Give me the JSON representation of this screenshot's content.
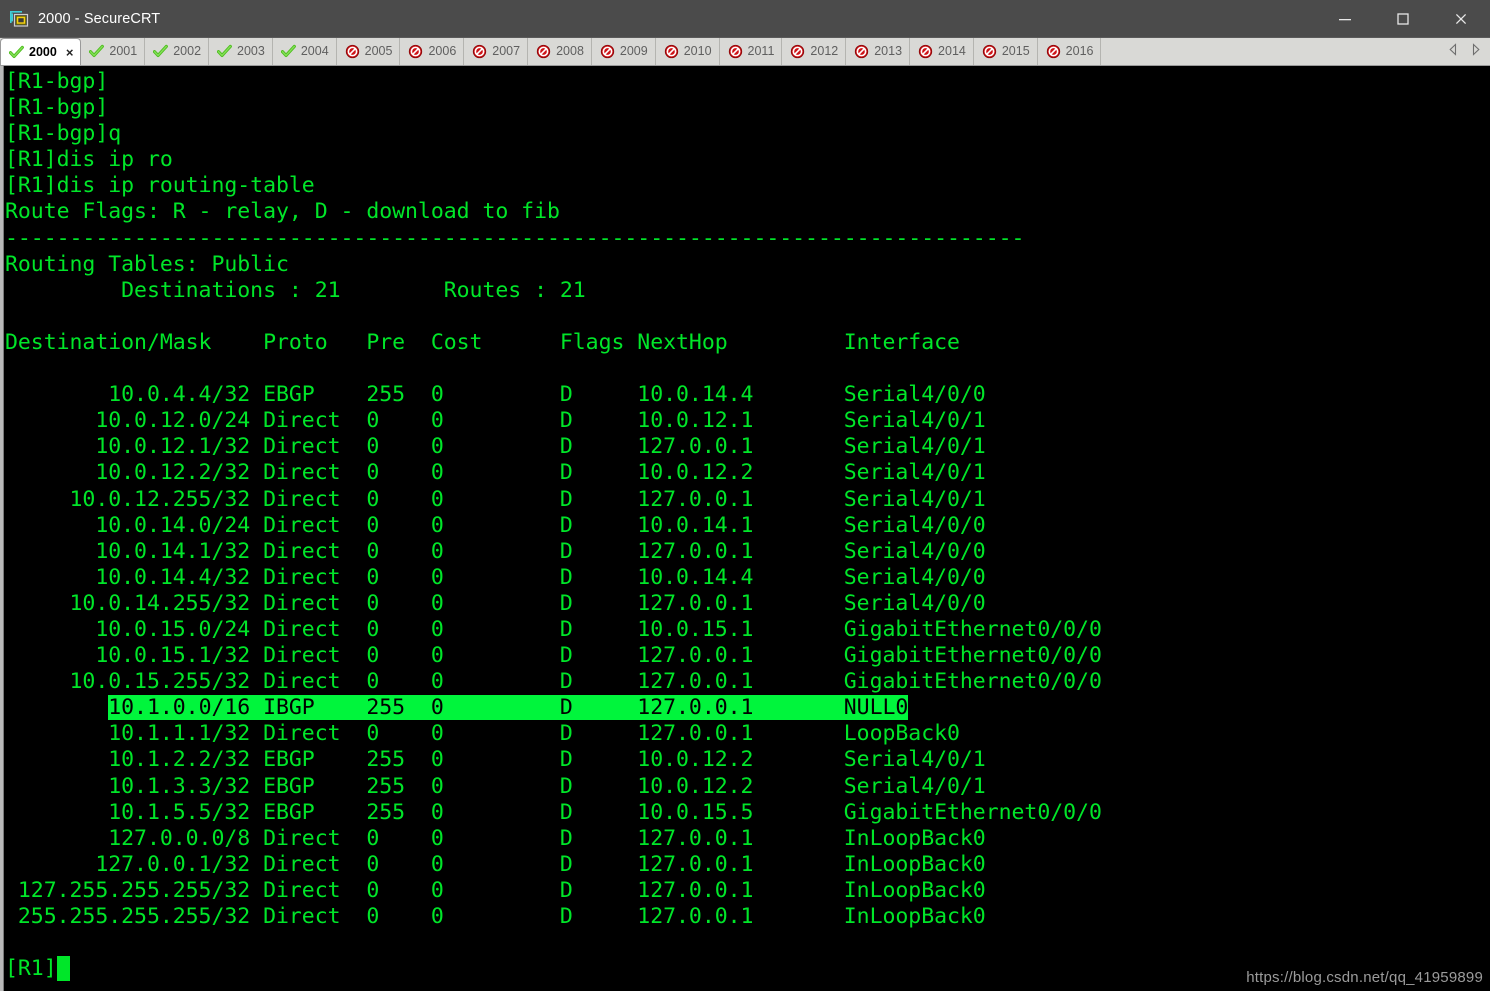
{
  "window": {
    "title": "2000 - SecureCRT",
    "app_icon": "securecrt-icon",
    "controls": {
      "minimize": "minimize-icon",
      "maximize": "maximize-icon",
      "close": "close-icon"
    }
  },
  "tabs": {
    "items": [
      {
        "label": "2000",
        "status": "connected",
        "active": true,
        "close_label": "×"
      },
      {
        "label": "2001",
        "status": "connected",
        "active": false
      },
      {
        "label": "2002",
        "status": "connected",
        "active": false
      },
      {
        "label": "2003",
        "status": "connected",
        "active": false
      },
      {
        "label": "2004",
        "status": "connected",
        "active": false
      },
      {
        "label": "2005",
        "status": "disconnected",
        "active": false
      },
      {
        "label": "2006",
        "status": "disconnected",
        "active": false
      },
      {
        "label": "2007",
        "status": "disconnected",
        "active": false
      },
      {
        "label": "2008",
        "status": "disconnected",
        "active": false
      },
      {
        "label": "2009",
        "status": "disconnected",
        "active": false
      },
      {
        "label": "2010",
        "status": "disconnected",
        "active": false
      },
      {
        "label": "2011",
        "status": "disconnected",
        "active": false
      },
      {
        "label": "2012",
        "status": "disconnected",
        "active": false
      },
      {
        "label": "2013",
        "status": "disconnected",
        "active": false
      },
      {
        "label": "2014",
        "status": "disconnected",
        "active": false
      },
      {
        "label": "2015",
        "status": "disconnected",
        "active": false
      },
      {
        "label": "2016",
        "status": "disconnected",
        "active": false
      }
    ],
    "scroll_left": "chevron-left-icon",
    "scroll_right": "chevron-right-icon"
  },
  "terminal": {
    "colors": {
      "background": "#000000",
      "foreground": "#00e629",
      "highlight_bg": "#00f53c",
      "highlight_fg": "#000000"
    },
    "prompt_lines": [
      "[R1-bgp]",
      "[R1-bgp]",
      "[R1-bgp]q",
      "[R1]dis ip ro",
      "[R1]dis ip routing-table"
    ],
    "route_flags": "Route Flags: R - relay, D - download to fib",
    "separator": "-------------------------------------------------------------------------------",
    "tables_label": "Routing Tables: Public",
    "summary": "         Destinations : 21        Routes : 21",
    "destinations_count": "21",
    "routes_count": "21",
    "header": "Destination/Mask    Proto   Pre  Cost      Flags NextHop         Interface",
    "columns": [
      "Destination/Mask",
      "Proto",
      "Pre",
      "Cost",
      "Flags",
      "NextHop",
      "Interface"
    ],
    "rows": [
      {
        "dest": "10.0.4.4/32",
        "proto": "EBGP",
        "pre": "255",
        "cost": "0",
        "flags": "D",
        "nexthop": "10.0.14.4",
        "interface": "Serial4/0/0",
        "highlighted": false
      },
      {
        "dest": "10.0.12.0/24",
        "proto": "Direct",
        "pre": "0",
        "cost": "0",
        "flags": "D",
        "nexthop": "10.0.12.1",
        "interface": "Serial4/0/1",
        "highlighted": false
      },
      {
        "dest": "10.0.12.1/32",
        "proto": "Direct",
        "pre": "0",
        "cost": "0",
        "flags": "D",
        "nexthop": "127.0.0.1",
        "interface": "Serial4/0/1",
        "highlighted": false
      },
      {
        "dest": "10.0.12.2/32",
        "proto": "Direct",
        "pre": "0",
        "cost": "0",
        "flags": "D",
        "nexthop": "10.0.12.2",
        "interface": "Serial4/0/1",
        "highlighted": false
      },
      {
        "dest": "10.0.12.255/32",
        "proto": "Direct",
        "pre": "0",
        "cost": "0",
        "flags": "D",
        "nexthop": "127.0.0.1",
        "interface": "Serial4/0/1",
        "highlighted": false
      },
      {
        "dest": "10.0.14.0/24",
        "proto": "Direct",
        "pre": "0",
        "cost": "0",
        "flags": "D",
        "nexthop": "10.0.14.1",
        "interface": "Serial4/0/0",
        "highlighted": false
      },
      {
        "dest": "10.0.14.1/32",
        "proto": "Direct",
        "pre": "0",
        "cost": "0",
        "flags": "D",
        "nexthop": "127.0.0.1",
        "interface": "Serial4/0/0",
        "highlighted": false
      },
      {
        "dest": "10.0.14.4/32",
        "proto": "Direct",
        "pre": "0",
        "cost": "0",
        "flags": "D",
        "nexthop": "10.0.14.4",
        "interface": "Serial4/0/0",
        "highlighted": false
      },
      {
        "dest": "10.0.14.255/32",
        "proto": "Direct",
        "pre": "0",
        "cost": "0",
        "flags": "D",
        "nexthop": "127.0.0.1",
        "interface": "Serial4/0/0",
        "highlighted": false
      },
      {
        "dest": "10.0.15.0/24",
        "proto": "Direct",
        "pre": "0",
        "cost": "0",
        "flags": "D",
        "nexthop": "10.0.15.1",
        "interface": "GigabitEthernet0/0/0",
        "highlighted": false
      },
      {
        "dest": "10.0.15.1/32",
        "proto": "Direct",
        "pre": "0",
        "cost": "0",
        "flags": "D",
        "nexthop": "127.0.0.1",
        "interface": "GigabitEthernet0/0/0",
        "highlighted": false
      },
      {
        "dest": "10.0.15.255/32",
        "proto": "Direct",
        "pre": "0",
        "cost": "0",
        "flags": "D",
        "nexthop": "127.0.0.1",
        "interface": "GigabitEthernet0/0/0",
        "highlighted": false
      },
      {
        "dest": "10.1.0.0/16",
        "proto": "IBGP",
        "pre": "255",
        "cost": "0",
        "flags": "D",
        "nexthop": "127.0.0.1",
        "interface": "NULL0",
        "highlighted": true
      },
      {
        "dest": "10.1.1.1/32",
        "proto": "Direct",
        "pre": "0",
        "cost": "0",
        "flags": "D",
        "nexthop": "127.0.0.1",
        "interface": "LoopBack0",
        "highlighted": false
      },
      {
        "dest": "10.1.2.2/32",
        "proto": "EBGP",
        "pre": "255",
        "cost": "0",
        "flags": "D",
        "nexthop": "10.0.12.2",
        "interface": "Serial4/0/1",
        "highlighted": false
      },
      {
        "dest": "10.1.3.3/32",
        "proto": "EBGP",
        "pre": "255",
        "cost": "0",
        "flags": "D",
        "nexthop": "10.0.12.2",
        "interface": "Serial4/0/1",
        "highlighted": false
      },
      {
        "dest": "10.1.5.5/32",
        "proto": "EBGP",
        "pre": "255",
        "cost": "0",
        "flags": "D",
        "nexthop": "10.0.15.5",
        "interface": "GigabitEthernet0/0/0",
        "highlighted": false
      },
      {
        "dest": "127.0.0.0/8",
        "proto": "Direct",
        "pre": "0",
        "cost": "0",
        "flags": "D",
        "nexthop": "127.0.0.1",
        "interface": "InLoopBack0",
        "highlighted": false
      },
      {
        "dest": "127.0.0.1/32",
        "proto": "Direct",
        "pre": "0",
        "cost": "0",
        "flags": "D",
        "nexthop": "127.0.0.1",
        "interface": "InLoopBack0",
        "highlighted": false
      },
      {
        "dest": "127.255.255.255/32",
        "proto": "Direct",
        "pre": "0",
        "cost": "0",
        "flags": "D",
        "nexthop": "127.0.0.1",
        "interface": "InLoopBack0",
        "highlighted": false
      },
      {
        "dest": "255.255.255.255/32",
        "proto": "Direct",
        "pre": "0",
        "cost": "0",
        "flags": "D",
        "nexthop": "127.0.0.1",
        "interface": "InLoopBack0",
        "highlighted": false
      }
    ],
    "final_prompt": "[R1]",
    "cursor": "block-cursor"
  },
  "watermark": {
    "text": "https://blog.csdn.net/qq_41959899"
  }
}
